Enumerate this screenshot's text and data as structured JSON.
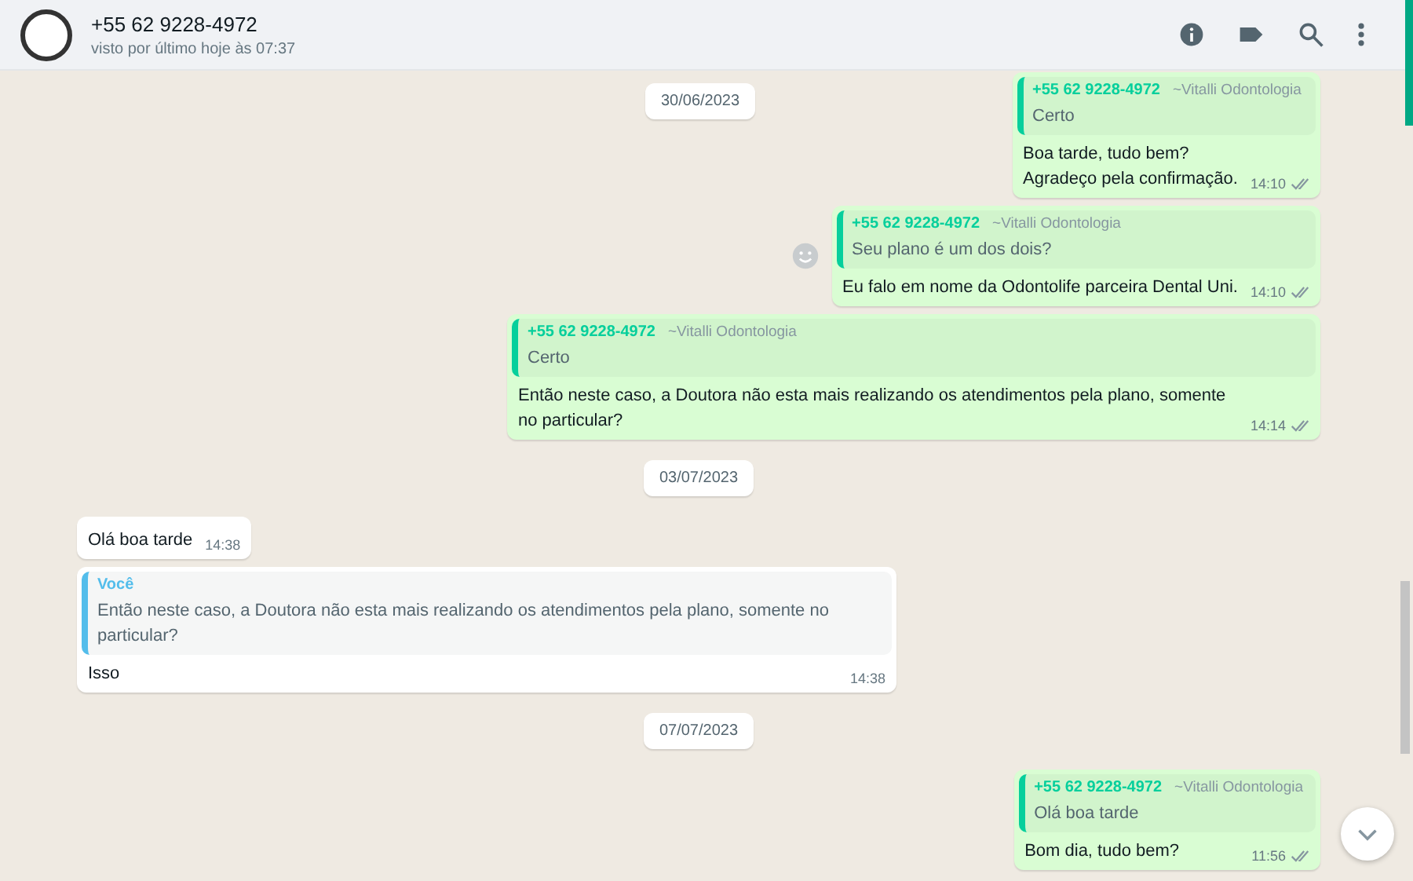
{
  "header": {
    "title": "+55 62 9228-4972",
    "subtitle": "visto por último hoje às 07:37"
  },
  "messages": [
    {
      "kind": "date",
      "text": "30/06/2023",
      "sticky": true
    },
    {
      "kind": "out",
      "quote": {
        "author": "+55 62 9228-4972",
        "author_name": "~Vitalli Odontologia",
        "text": "Certo"
      },
      "text": "Boa tarde, tudo bem?\nAgradeço pela confirmação.",
      "time": "14:10"
    },
    {
      "kind": "out",
      "quote": {
        "author": "+55 62 9228-4972",
        "author_name": "~Vitalli Odontologia",
        "text": "Seu plano é um dos dois?"
      },
      "text": "Eu falo em nome da Odontolife parceira Dental Uni.",
      "time": "14:10",
      "reaction_button": true
    },
    {
      "kind": "out",
      "quote": {
        "author": "+55 62 9228-4972",
        "author_name": "~Vitalli Odontologia",
        "text": "Certo"
      },
      "text": "Então neste caso, a Doutora não esta mais realizando os atendimentos pela plano, somente no particular?",
      "time": "14:14"
    },
    {
      "kind": "date",
      "text": "03/07/2023"
    },
    {
      "kind": "in",
      "text": "Olá boa tarde",
      "time": "14:38"
    },
    {
      "kind": "in",
      "quote": {
        "author": "Você",
        "text": "Então neste caso, a Doutora não esta mais realizando os atendimentos pela plano, somente no particular?"
      },
      "text": "Isso",
      "time": "14:38"
    },
    {
      "kind": "date",
      "text": "07/07/2023"
    },
    {
      "kind": "out",
      "quote": {
        "author": "+55 62 9228-4972",
        "author_name": "~Vitalli Odontologia",
        "text": "Olá boa tarde"
      },
      "text": "Bom dia, tudo bem?",
      "time": "11:56"
    }
  ]
}
